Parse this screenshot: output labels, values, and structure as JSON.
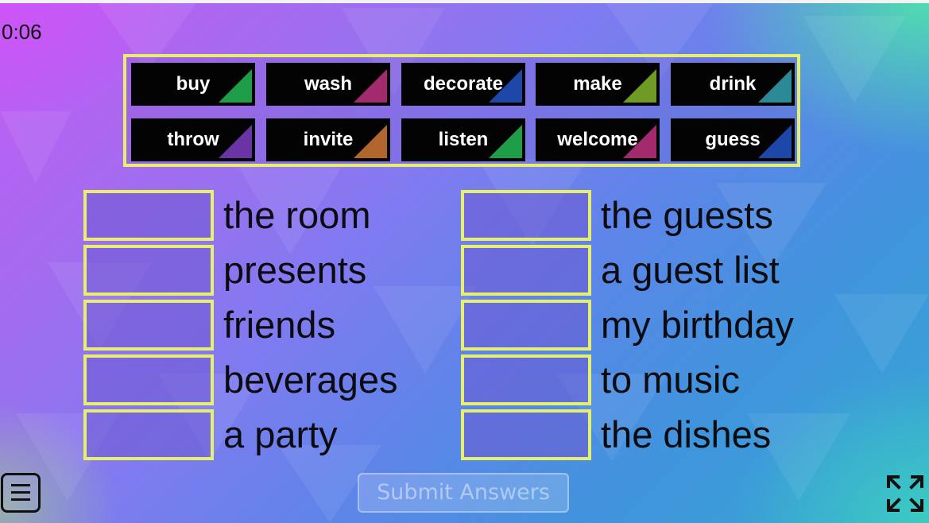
{
  "timer": "0:06",
  "word_bank": [
    {
      "word": "buy",
      "color": "#1f9e4a"
    },
    {
      "word": "wash",
      "color": "#a42a6e"
    },
    {
      "word": "decorate",
      "color": "#1d47a8"
    },
    {
      "word": "make",
      "color": "#6f9a26"
    },
    {
      "word": "drink",
      "color": "#2a8a96"
    },
    {
      "word": "throw",
      "color": "#6a34a6"
    },
    {
      "word": "invite",
      "color": "#b0662c"
    },
    {
      "word": "listen",
      "color": "#1f9e4a"
    },
    {
      "word": "welcome",
      "color": "#a42a6e"
    },
    {
      "word": "guess",
      "color": "#1d47a8"
    }
  ],
  "left_column": [
    {
      "answer": "",
      "phrase": "the room"
    },
    {
      "answer": "",
      "phrase": "presents"
    },
    {
      "answer": "",
      "phrase": "friends"
    },
    {
      "answer": "",
      "phrase": "beverages"
    },
    {
      "answer": "",
      "phrase": "a party"
    }
  ],
  "right_column": [
    {
      "answer": "",
      "phrase": "the guests"
    },
    {
      "answer": "",
      "phrase": "a guest list"
    },
    {
      "answer": "",
      "phrase": "my birthday"
    },
    {
      "answer": "",
      "phrase": "to music"
    },
    {
      "answer": "",
      "phrase": "the dishes"
    }
  ],
  "submit_label": "Submit Answers",
  "theme": {
    "accent_border": "#e6f06a",
    "tile_background": "#030303"
  },
  "icons": {
    "menu": "hamburger-menu-icon",
    "fullscreen": "fullscreen-expand-icon"
  }
}
